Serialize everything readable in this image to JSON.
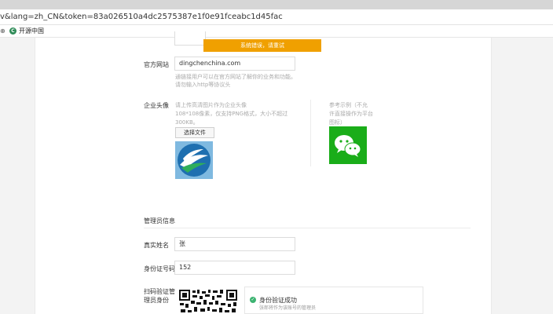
{
  "browser": {
    "url": "v&lang=zh_CN&token=83a026510a4dc2575387e1f0e91fceabc1d45fac",
    "bookmark_left": "⊕",
    "bookmark_label": "开源中国",
    "bookmark_icon_letter": "C"
  },
  "toast": {
    "text": "系统错误，请重试"
  },
  "form": {
    "website": {
      "label": "官方网站",
      "value": "dingchenchina.com",
      "hint_line1": "通链接用户可以在官方网站了解你的业务和功能。",
      "hint_line2": "请勿输入http等协议头"
    },
    "avatar": {
      "label": "企业头像",
      "hint_line1": "请上传高清图片作为企业头像",
      "hint_line2": "108*108像素，仅支持PNG格式，大小不超过",
      "hint_line3": "300KB。",
      "button": "选择文件",
      "example_line1": "参考示例（不允",
      "example_line2": "许直接操作为平台",
      "example_line3": "图标）"
    },
    "admin": {
      "section_title": "管理员信息",
      "name_label": "真实姓名",
      "name_value": "张",
      "id_label": "身份证号码",
      "id_value": "152",
      "scan_label_line1": "扫码验证管",
      "scan_label_line2": "理员身份",
      "verify_success": "身份验证成功",
      "verify_sub": "张郎将作为该账号的管理员"
    }
  },
  "colors": {
    "toast": "#f0a000",
    "wechat_green": "#1aad19",
    "success_green": "#3cb371"
  }
}
